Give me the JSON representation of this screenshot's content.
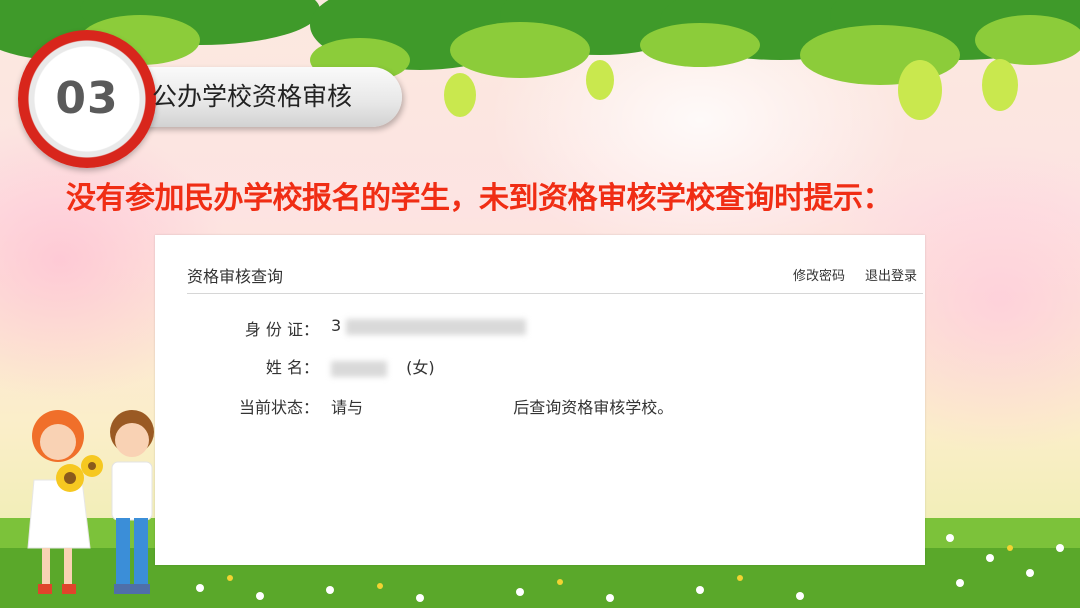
{
  "section": {
    "number": "03",
    "title": "公办学校资格审核"
  },
  "headline": "没有参加民办学校报名的学生，未到资格审核学校查询时提示：",
  "panel": {
    "title": "资格审核查询",
    "links": {
      "change_password": "修改密码",
      "logout": "退出登录"
    },
    "fields": {
      "id_label": "身 份 证：",
      "id_value_prefix": "3",
      "name_label": "姓    名：",
      "name_value_prefix": "張",
      "gender": "(女)",
      "status_label": "当前状态：",
      "status_prefix": "请与",
      "status_suffix": "后查询资格审核学校。"
    }
  },
  "colors": {
    "headline": "#f02d14",
    "badge_ring": "#d8261c",
    "panel_bg": "#ffffff"
  }
}
